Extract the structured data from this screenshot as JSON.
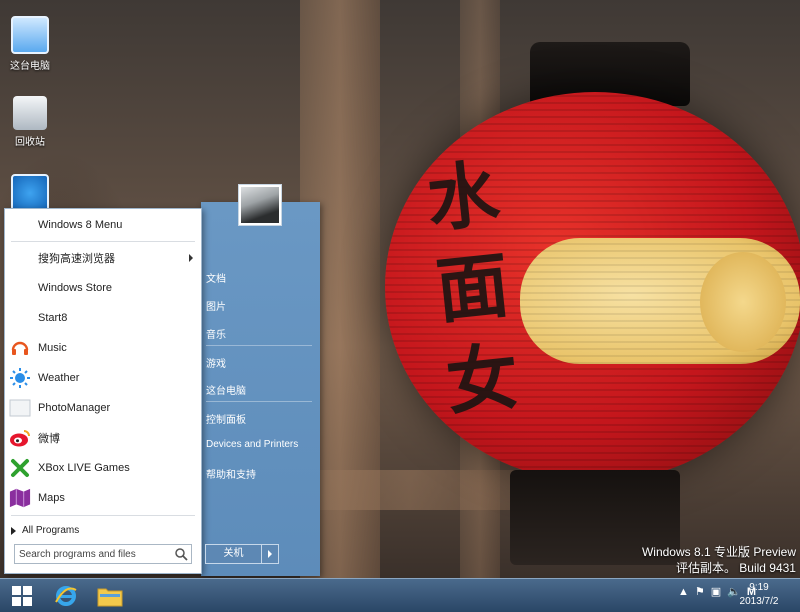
{
  "desktop": {
    "icons": [
      {
        "label": "这台电脑",
        "icon": "computer-icon"
      },
      {
        "label": "回收站",
        "icon": "recycle-bin-icon"
      },
      {
        "label": "",
        "icon": "sogou-browser-icon"
      }
    ],
    "watermark": {
      "line1": "Windows 8.1 专业版 Preview",
      "line2": "评估副本。 Build 9431"
    }
  },
  "start_menu": {
    "programs": [
      {
        "label": "Windows 8 Menu",
        "icon": ""
      },
      {
        "label": "搜狗高速浏览器",
        "icon": "",
        "submenu": true
      },
      {
        "label": "Windows Store",
        "icon": ""
      },
      {
        "label": "Start8",
        "icon": ""
      },
      {
        "label": "Music",
        "icon": "headphones-icon"
      },
      {
        "label": "Weather",
        "icon": "sun-icon"
      },
      {
        "label": "PhotoManager",
        "icon": "photo-icon"
      },
      {
        "label": "微博",
        "icon": "weibo-icon"
      },
      {
        "label": "XBox LIVE Games",
        "icon": "xbox-icon"
      },
      {
        "label": "Maps",
        "icon": "maps-icon"
      }
    ],
    "all_programs": "All Programs",
    "search_placeholder": "Search programs and files",
    "right_items": [
      {
        "label": "文档"
      },
      {
        "label": "图片"
      },
      {
        "label": "音乐"
      },
      {
        "label": "游戏"
      },
      {
        "label": "这台电脑"
      },
      {
        "label": "控制面板"
      },
      {
        "label": "Devices and Printers"
      },
      {
        "label": "帮助和支持"
      }
    ],
    "shutdown_label": "关机"
  },
  "taskbar": {
    "clock_time": "9:19",
    "clock_date": "2013/7/2",
    "tray_ime": "M"
  },
  "colors": {
    "menu_right": "#6a98c4",
    "taskbar": "#2a4666"
  }
}
